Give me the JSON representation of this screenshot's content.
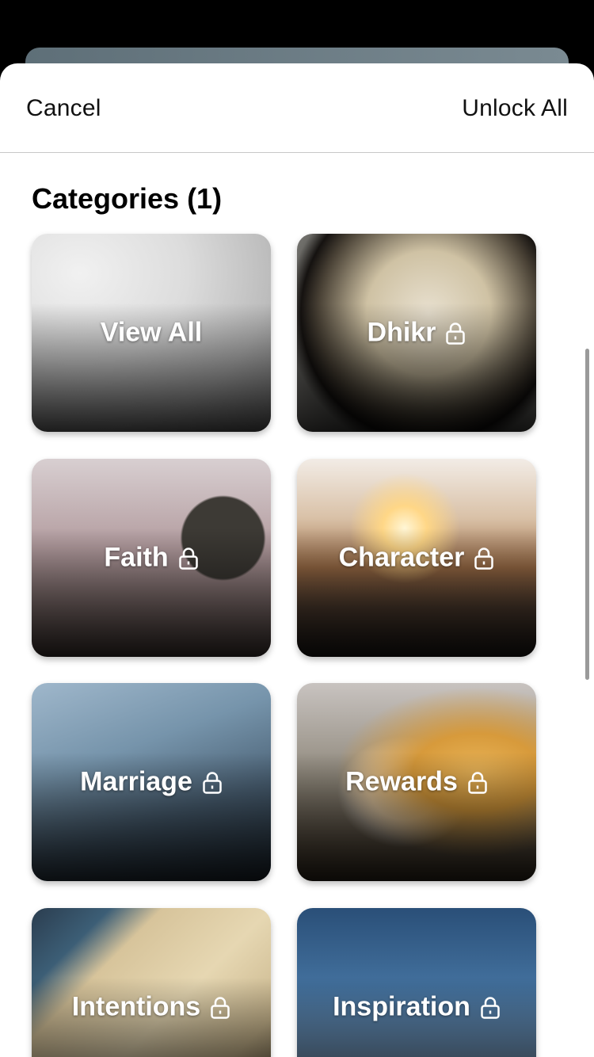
{
  "navbar": {
    "cancel_label": "Cancel",
    "unlock_all_label": "Unlock All"
  },
  "heading": "Categories (1)",
  "categories": [
    {
      "label": "View All",
      "locked": false
    },
    {
      "label": "Dhikr",
      "locked": true
    },
    {
      "label": "Faith",
      "locked": true
    },
    {
      "label": "Character",
      "locked": true
    },
    {
      "label": "Marriage",
      "locked": true
    },
    {
      "label": "Rewards",
      "locked": true
    },
    {
      "label": "Intentions",
      "locked": true
    },
    {
      "label": "Inspiration",
      "locked": true
    }
  ],
  "icons": {
    "lock": "lock-icon"
  },
  "colors": {
    "text": "#111111",
    "sheet": "#ffffff",
    "backdrop": "#000000"
  }
}
